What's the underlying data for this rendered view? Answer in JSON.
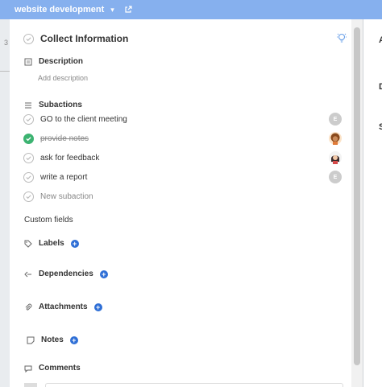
{
  "header": {
    "project": "website development"
  },
  "task": {
    "title": "Collect Information"
  },
  "description": {
    "heading": "Description",
    "placeholder": "Add description"
  },
  "subactions": {
    "heading": "Subactions",
    "items": [
      {
        "label": "GO to the client meeting",
        "done": false,
        "avatar": "E"
      },
      {
        "label": "provide notes",
        "done": true,
        "avatar": ""
      },
      {
        "label": "ask for feedback",
        "done": false,
        "avatar": ""
      },
      {
        "label": "write a report",
        "done": false,
        "avatar": "E"
      }
    ],
    "new_placeholder": "New subaction"
  },
  "custom_fields": {
    "heading": "Custom fields"
  },
  "fields": {
    "labels": "Labels",
    "dependencies": "Dependencies",
    "attachments": "Attachments",
    "notes": "Notes",
    "comments": "Comments"
  },
  "side": {
    "a": "A",
    "d": "D",
    "s": "S"
  },
  "bg": {
    "num": "3"
  },
  "colors": {
    "header": "#86b0ee",
    "plus": "#2f6fd6",
    "done": "#3cb371"
  }
}
